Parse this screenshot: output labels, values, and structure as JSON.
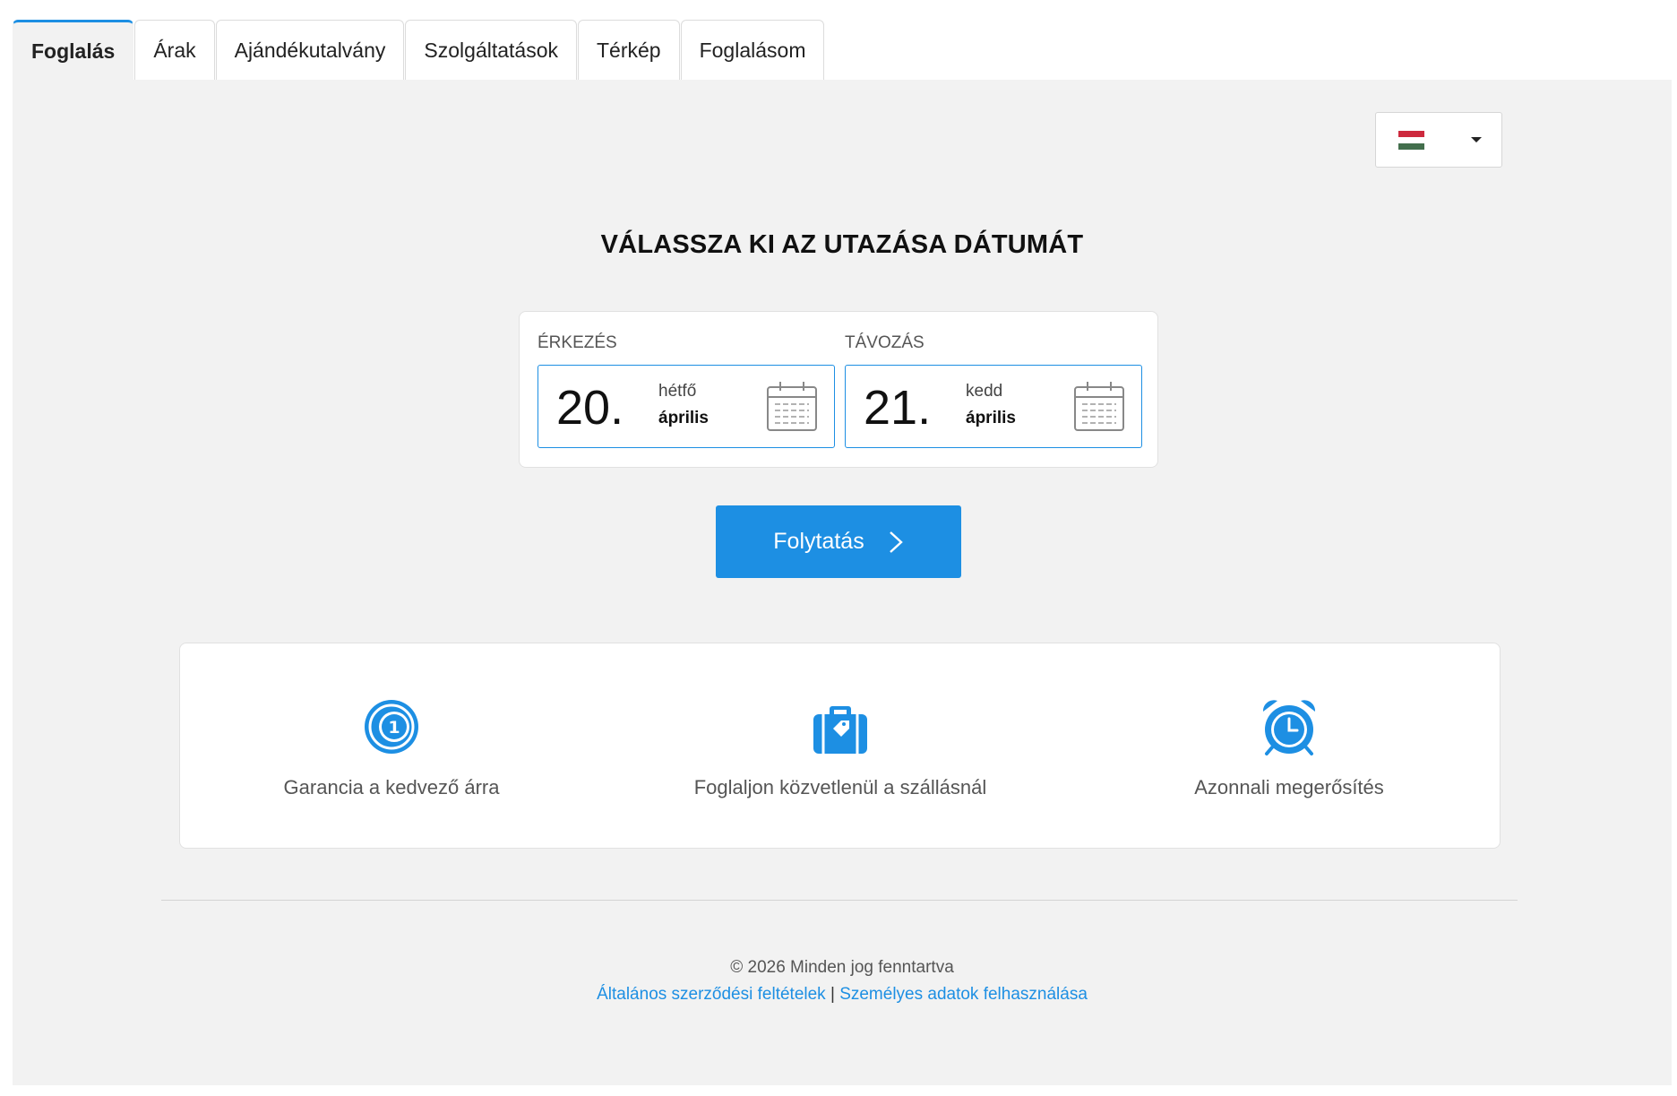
{
  "tabs": [
    {
      "label": "Foglalás",
      "active": true
    },
    {
      "label": "Árak"
    },
    {
      "label": "Ajándékutalvány"
    },
    {
      "label": "Szolgáltatások"
    },
    {
      "label": "Térkép"
    },
    {
      "label": "Foglalásom"
    }
  ],
  "language": {
    "flag": "hungarian-flag-icon",
    "colors": [
      "#cd2a3e",
      "#ffffff",
      "#436f4d"
    ]
  },
  "heading": "VÁLASSZA KI AZ UTAZÁSA DÁTUMÁT",
  "arrival": {
    "label": "ÉRKEZÉS",
    "day": "20.",
    "weekday": "hétfő",
    "month": "április"
  },
  "departure": {
    "label": "TÁVOZÁS",
    "day": "21.",
    "weekday": "kedd",
    "month": "április"
  },
  "continue_label": "Folytatás",
  "features": [
    {
      "icon": "best-price-guarantee-icon",
      "text": "Garancia a kedvező árra"
    },
    {
      "icon": "suitcase-icon",
      "text": "Foglaljon közvetlenül a szállásnál"
    },
    {
      "icon": "alarm-clock-icon",
      "text": "Azonnali megerősítés"
    }
  ],
  "footer": {
    "copyright": "© 2026 Minden jog fenntartva",
    "terms_link": "Általános szerződési feltételek",
    "separator": "|",
    "privacy_link": "Személyes adatok felhasználása"
  },
  "colors": {
    "accent": "#1d8fe3",
    "panel_bg": "#f2f2f2"
  }
}
